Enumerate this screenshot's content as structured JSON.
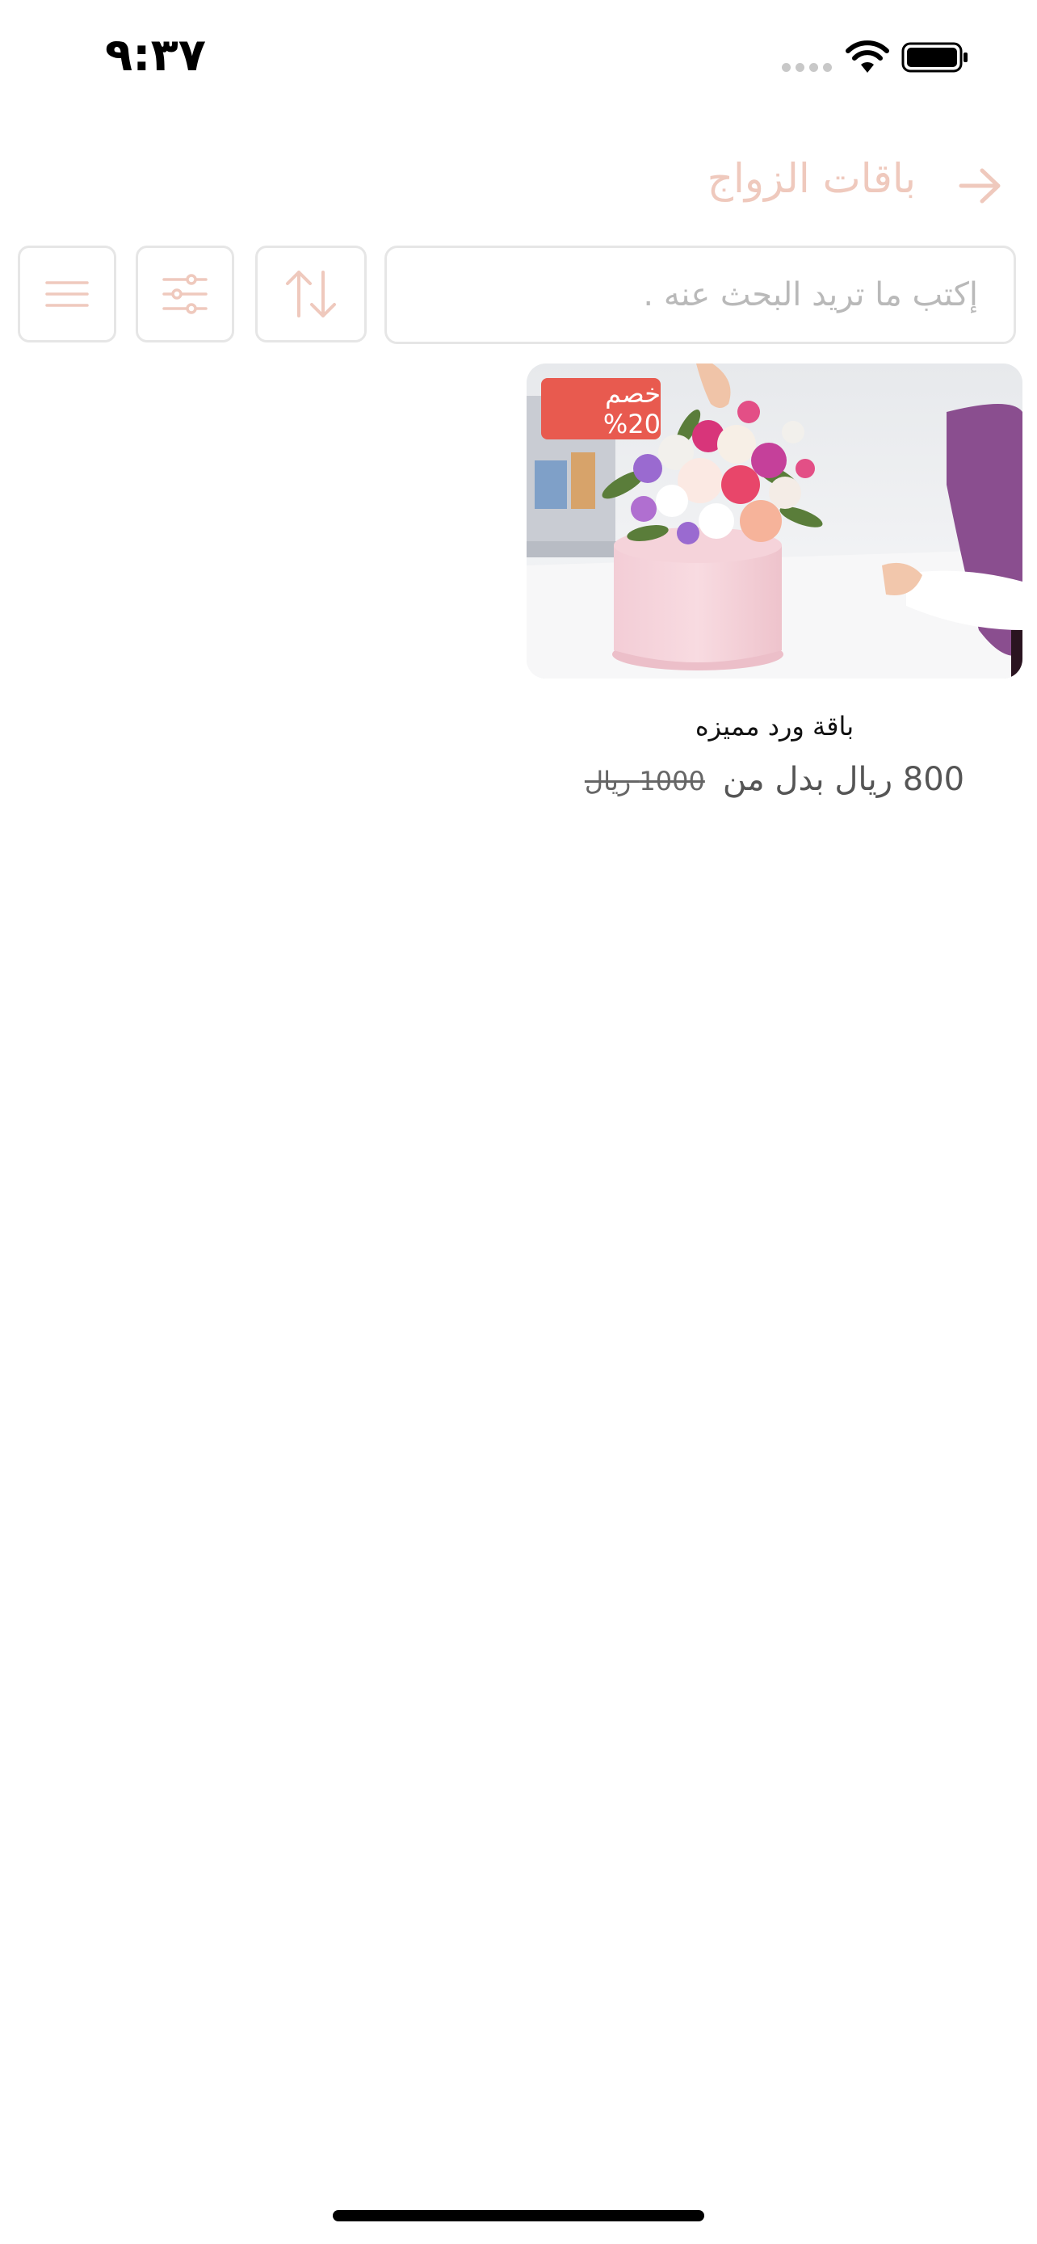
{
  "status_bar": {
    "time": "٩:٣٧",
    "icons": [
      "signal-dots-icon",
      "wifi-icon",
      "battery-icon"
    ]
  },
  "header": {
    "title": "باقات الزواج",
    "back_icon": "arrow-right-icon"
  },
  "toolbar": {
    "search_placeholder": "إكتب ما تريد البحث عنه .",
    "search_value": "",
    "sort_icon": "sort-arrows-icon",
    "filter_icon": "sliders-icon",
    "menu_icon": "menu-lines-icon"
  },
  "products": [
    {
      "name": "باقة ورد مميزه",
      "discount_badge": "خصم 20%",
      "price_new": "800 ريال بدل من",
      "price_old": "1000 ريال"
    }
  ],
  "colors": {
    "accent": "#efc9bd",
    "badge": "#e85a4f",
    "border": "#e6e6e6"
  }
}
